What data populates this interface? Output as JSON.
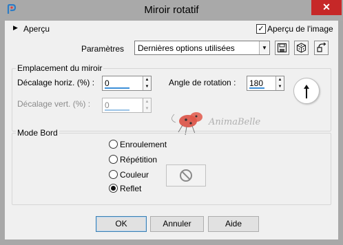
{
  "window": {
    "title": "Miroir rotatif",
    "close_glyph": "✕",
    "app_icon": "paintshop-icon"
  },
  "preview": {
    "expander_glyph": "▶",
    "label": "Aperçu",
    "image_preview_label": "Aperçu de l'image",
    "image_preview_checked": true
  },
  "presets": {
    "label": "Paramètres",
    "selected": "Dernières options utilisées",
    "tools": [
      "save-preset-icon",
      "randomize-icon",
      "reset-icon"
    ]
  },
  "mirror": {
    "group_title": "Emplacement du miroir",
    "h_offset_label": "Décalage horiz. (%) :",
    "h_offset_value": "0",
    "v_offset_label": "Décalage vert. (%) :",
    "v_offset_value": "0",
    "rotation_label": "Angle de rotation :",
    "rotation_value": "180"
  },
  "edge": {
    "group_title": "Mode Bord",
    "options": [
      "Enroulement",
      "Répétition",
      "Couleur",
      "Reflet"
    ],
    "selected": "Reflet"
  },
  "watermark": {
    "text": "AnimaBelle"
  },
  "buttons": {
    "ok": "OK",
    "cancel": "Annuler",
    "help": "Aide"
  },
  "colors": {
    "accent": "#3c8fd8",
    "close": "#c62828",
    "titlebar": "#a9a9a9",
    "dialog_bg": "#f0f0f0"
  }
}
